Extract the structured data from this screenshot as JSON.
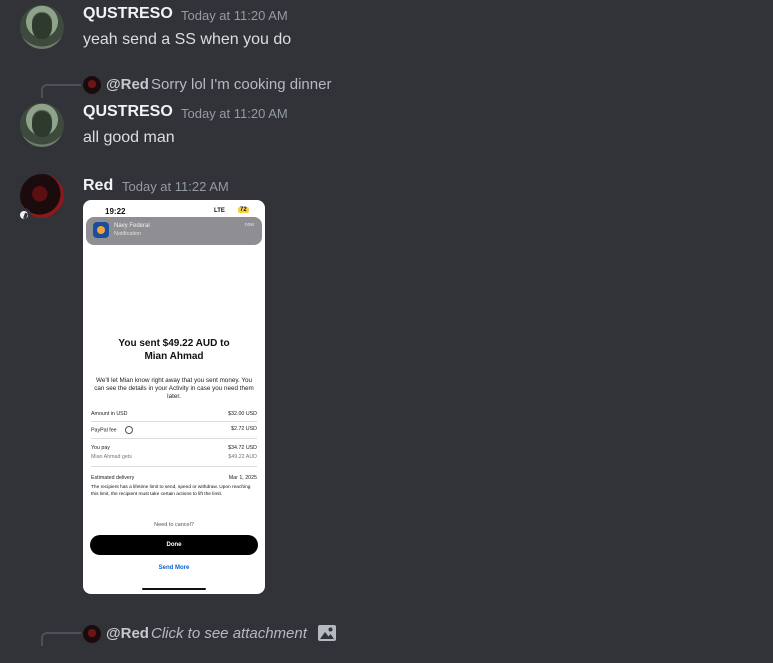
{
  "messages": [
    {
      "author": "QUSTRESO",
      "timestamp": "Today at 11:20 AM",
      "text": "yeah send a SS when you do"
    },
    {
      "reply": {
        "mention": "@Red",
        "text": "Sorry lol I'm cooking dinner"
      },
      "author": "QUSTRESO",
      "timestamp": "Today at 11:20 AM",
      "text": "all good man"
    },
    {
      "author": "Red",
      "timestamp": "Today at 11:22 AM",
      "attachment": {
        "status_time": "19:22",
        "status_signal": "LTE",
        "status_battery": "72",
        "notification_title": "Navy Federal",
        "notification_sub": "Notification",
        "notification_time": "now",
        "heading_line1": "You sent $49.22 AUD to",
        "heading_line2": "Mian Ahmad",
        "description": "We'll let Mian know right away that you sent money. You can see the details in your Activity in case you need them later.",
        "rows": [
          {
            "label": "Amount in USD",
            "value": "$32.00 USD"
          },
          {
            "label": "PayPal fee",
            "value": "$2.72 USD"
          },
          {
            "label": "You pay",
            "value": "$34.72 USD"
          },
          {
            "label": "Mian Ahmad gets",
            "value": "$49.22 AUD"
          }
        ],
        "delivery_label": "Estimated delivery",
        "delivery_value": "Mar 1, 2025",
        "limit_note": "The recipient has a lifetime limit to send, spend or withdraw. Upon reaching this limit, the recipient must take certain actions to lift the limit.",
        "cancel_prompt": "Need to cancel?",
        "done_button": "Done",
        "send_more": "Send More"
      }
    },
    {
      "reply": {
        "mention": "@Red",
        "text": "Click to see attachment"
      }
    }
  ]
}
